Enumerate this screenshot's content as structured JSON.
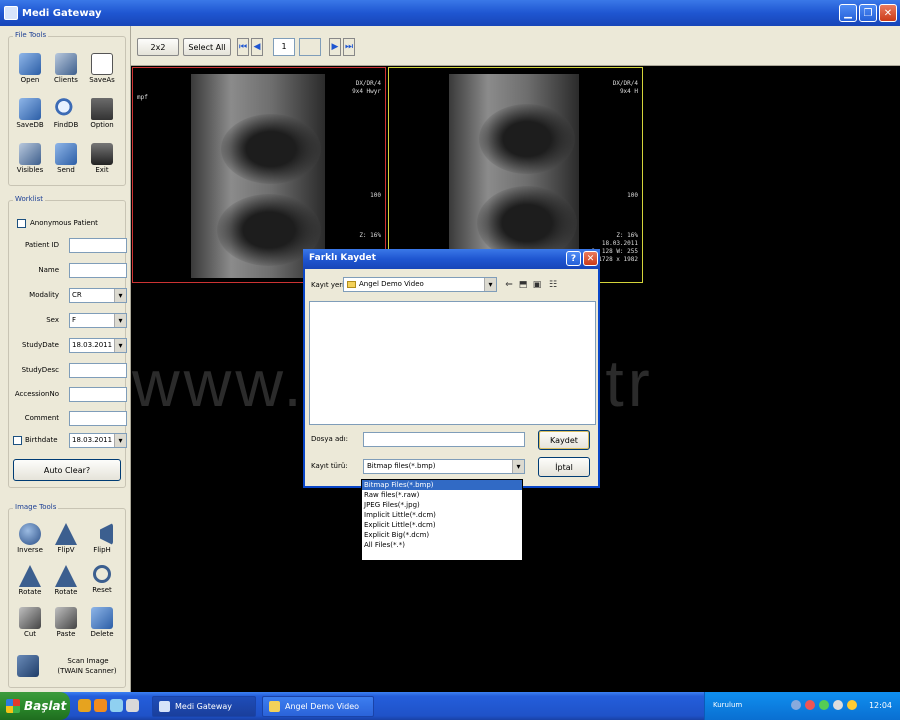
{
  "window": {
    "title": "Medi Gateway"
  },
  "left_panel": {
    "file_tools": {
      "title": "File Tools",
      "tools": [
        {
          "label": "Open"
        },
        {
          "label": "Clients"
        },
        {
          "label": "SaveAs"
        },
        {
          "label": "SaveDB"
        },
        {
          "label": "FindDB"
        },
        {
          "label": "Option"
        },
        {
          "label": "Visibles"
        },
        {
          "label": "Send"
        },
        {
          "label": "Exit"
        }
      ]
    },
    "worklist": {
      "title": "Worklist",
      "anonymous_label": "Anonymous Patient",
      "fields": [
        {
          "label": "Patient ID",
          "value": ""
        },
        {
          "label": "Name",
          "value": ""
        },
        {
          "label": "Modality",
          "value": "CR"
        },
        {
          "label": "Sex",
          "value": "F"
        },
        {
          "label": "StudyDate",
          "value": "18.03.2011"
        },
        {
          "label": "StudyDesc",
          "value": ""
        },
        {
          "label": "AccessionNo",
          "value": ""
        },
        {
          "label": "Comment",
          "value": ""
        }
      ],
      "birthdate_label": "Birthdate",
      "birthdate_value": "18.03.2011",
      "auto_clear_label": "Auto Clear?"
    },
    "image_tools": {
      "title": "Image Tools",
      "tools": [
        {
          "label": "Inverse"
        },
        {
          "label": "FlipV"
        },
        {
          "label": "FlipH"
        },
        {
          "label": "Rotate"
        },
        {
          "label": "Rotate"
        },
        {
          "label": "Reset"
        },
        {
          "label": "Cut"
        },
        {
          "label": "Paste"
        },
        {
          "label": "Delete"
        }
      ],
      "scan_label": "Scan Image",
      "scan_sublabel": "(TWAIN Scanner)"
    }
  },
  "toolbar": {
    "btn_2x2": "2x2",
    "btn_select_all": "Select All",
    "page_value": "1",
    "page_total": ""
  },
  "viewports": [
    {
      "left_label": "mpf",
      "overlay_lines": [
        "DX/DR/4",
        "9x4 Hwyr",
        "",
        "",
        "",
        "",
        "",
        "",
        "",
        "",
        "",
        "100",
        "",
        "",
        "",
        "",
        "",
        "",
        "Z: 16%"
      ]
    },
    {
      "left_label": "",
      "overlay_lines": [
        "DX/DR/4",
        "9x4 H",
        "",
        "",
        "",
        "",
        "",
        "",
        "",
        "",
        "",
        "100",
        "",
        "",
        "",
        "",
        "",
        "",
        "Z: 16%",
        "18.03.2011",
        "C: 128 W: 255",
        "1728 x 1982"
      ]
    }
  ],
  "watermark": "www.eml.com.tr",
  "dialog": {
    "title": "Farklı Kaydet",
    "kayit_yeri_label": "Kayıt yeri:",
    "kayit_yeri_value": "Angel Demo Video",
    "dosya_adi_label": "Dosya adı:",
    "dosya_adi_value": "",
    "kayit_turu_label": "Kayıt türü:",
    "kayit_turu_value": "Bitmap files(*.bmp)",
    "save_button": "Kaydet",
    "cancel_button": "İptal",
    "help_glyph": "?",
    "close_glyph": "✕"
  },
  "file_type_options": [
    "Bitmap Files(*.bmp)",
    "Raw files(*.raw)",
    "JPEG Files(*.jpg)",
    "Implicit Little(*.dcm)",
    "Explicit Little(*.dcm)",
    "Explicit Big(*.dcm)",
    "All Files(*.*)"
  ],
  "taskbar": {
    "start_label": "Başlat",
    "tasks": [
      {
        "label": "Medi Gateway"
      },
      {
        "label": "Angel Demo Video"
      }
    ],
    "language": "Kurulum",
    "clock": "12:04"
  },
  "colors": {
    "xp_blue": "#1f56d1",
    "panel_bg": "#ece9d8",
    "viewport1_border": "#cc3333",
    "viewport2_border": "#d4d43a",
    "selected_option": "#316ac5"
  }
}
